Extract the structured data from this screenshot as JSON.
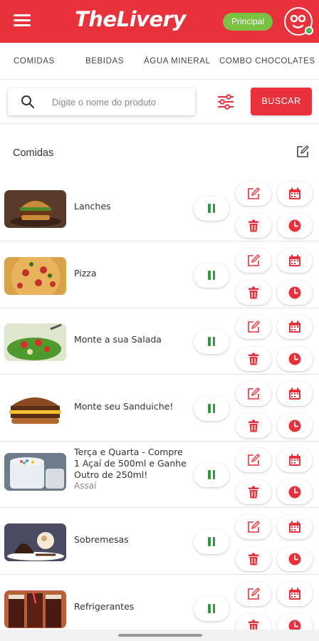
{
  "header": {
    "logo": "TheLivery",
    "badge": "Principal",
    "brand_color": "#e8313b",
    "badge_color": "#7cc242",
    "menu_icon": "hamburger-icon",
    "avatar_icon": "face-icon"
  },
  "tabs": [
    "COMIDAS",
    "BEBIDAS",
    "ÁGUA MINERAL",
    "COMBO CHOCOLATES"
  ],
  "search": {
    "placeholder": "Digite o nome do produto",
    "button_label": "BUSCAR",
    "filter_icon": "sliders-icon"
  },
  "section": {
    "title": "Comidas",
    "edit_icon": "edit-icon"
  },
  "items": [
    {
      "name": "Lanches",
      "subtitle": "",
      "image": "burger"
    },
    {
      "name": "Pizza",
      "subtitle": "",
      "image": "pizza"
    },
    {
      "name": "Monte a sua Salada",
      "subtitle": "",
      "image": "salad"
    },
    {
      "name": "Monte seu Sanduiche!",
      "subtitle": "",
      "image": "sandwich"
    },
    {
      "name": "Terça e Quarta - Compre 1 Açaí de 500ml e Ganhe Outro de 250ml!",
      "subtitle": "Assaí",
      "image": "acai"
    },
    {
      "name": "Sobremesas",
      "subtitle": "",
      "image": "dessert"
    },
    {
      "name": "Refrigerantes",
      "subtitle": "",
      "image": "soda"
    }
  ],
  "action_colors": {
    "pause": "#2e9a3e",
    "actions": "#e8313b"
  }
}
